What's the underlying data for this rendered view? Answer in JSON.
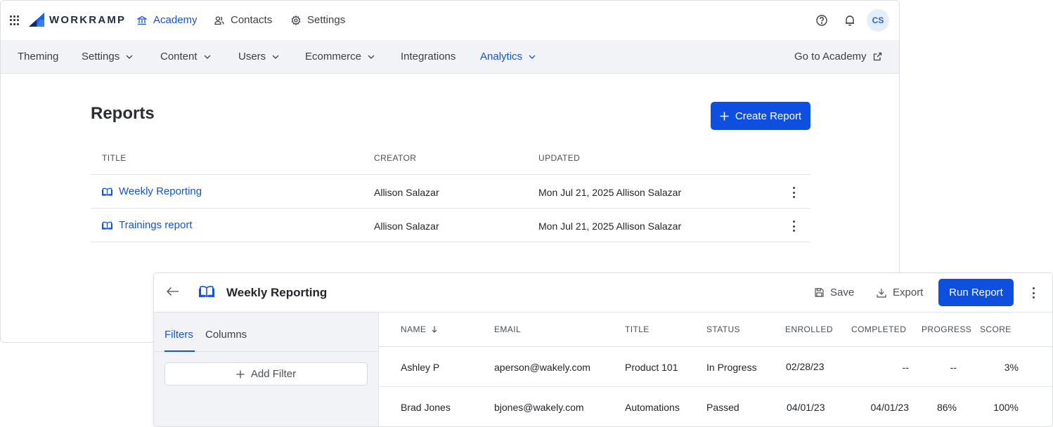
{
  "topbar": {
    "brand": "WORKRAMP",
    "nav": [
      {
        "label": "Academy",
        "icon": "building-icon",
        "active": true
      },
      {
        "label": "Contacts",
        "icon": "contacts-icon",
        "active": false
      },
      {
        "label": "Settings",
        "icon": "gear-icon",
        "active": false
      }
    ],
    "avatar_initials": "CS"
  },
  "subnav": {
    "items": [
      {
        "label": "Theming",
        "dropdown": false
      },
      {
        "label": "Settings",
        "dropdown": true
      },
      {
        "label": "Content",
        "dropdown": true
      },
      {
        "label": "Users",
        "dropdown": true
      },
      {
        "label": "Ecommerce",
        "dropdown": true
      },
      {
        "label": "Integrations",
        "dropdown": false
      },
      {
        "label": "Analytics",
        "dropdown": true,
        "active": true
      }
    ],
    "go_to_academy": "Go to Academy"
  },
  "reports": {
    "title": "Reports",
    "create_label": "Create Report",
    "columns": [
      "TITLE",
      "CREATOR",
      "UPDATED"
    ],
    "rows": [
      {
        "title": "Weekly Reporting",
        "creator": "Allison Salazar",
        "updated": "Mon Jul 21, 2025 Allison Salazar"
      },
      {
        "title": "Trainings report",
        "creator": "Allison Salazar",
        "updated": "Mon Jul 21, 2025 Allison Salazar"
      }
    ]
  },
  "report_panel": {
    "title": "Weekly Reporting",
    "save_label": "Save",
    "export_label": "Export",
    "run_label": "Run Report",
    "tabs": [
      "Filters",
      "Columns"
    ],
    "add_filter_label": "Add Filter",
    "columns": [
      "NAME",
      "EMAIL",
      "TITLE",
      "STATUS",
      "ENROLLED",
      "COMPLETED",
      "PROGRESS",
      "SCORE"
    ],
    "sort_icon": "arrow-down-icon",
    "rows": [
      {
        "name": "Ashley P",
        "email": "aperson@wakely.com",
        "title": "Product 101",
        "status": "In Progress",
        "enrolled": "02/28/23",
        "completed": "--",
        "progress": "--",
        "score": "3%"
      },
      {
        "name": "Brad Jones",
        "email": "bjones@wakely.com",
        "title": "Automations",
        "status": "Passed",
        "enrolled": "04/01/23",
        "completed": "04/01/23",
        "progress": "86%",
        "score": "100%"
      }
    ]
  },
  "colors": {
    "accent": "#0f4fe0",
    "link": "#1453d6",
    "subnav_bg": "#f1f3f6"
  }
}
